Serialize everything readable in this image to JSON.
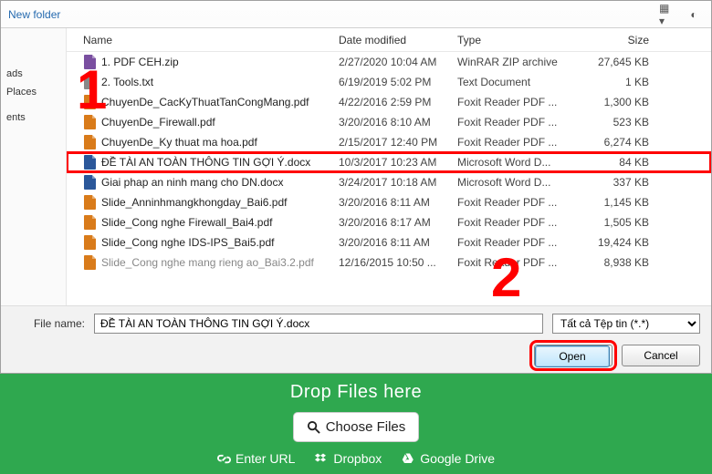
{
  "toolbar": {
    "new_folder": "New folder"
  },
  "sidebar": {
    "items": [
      "ads",
      "Places",
      "",
      "ents"
    ]
  },
  "columns": {
    "name": "Name",
    "date": "Date modified",
    "type": "Type",
    "size": "Size"
  },
  "files": [
    {
      "icon": "zip",
      "name": "1. PDF CEH.zip",
      "date": "2/27/2020 10:04 AM",
      "type": "WinRAR ZIP archive",
      "size": "27,645 KB"
    },
    {
      "icon": "txt",
      "name": "2. Tools.txt",
      "date": "6/19/2019 5:02 PM",
      "type": "Text Document",
      "size": "1 KB"
    },
    {
      "icon": "pdf",
      "name": "ChuyenDe_CacKyThuatTanCongMang.pdf",
      "date": "4/22/2016 2:59 PM",
      "type": "Foxit Reader PDF ...",
      "size": "1,300 KB"
    },
    {
      "icon": "pdf",
      "name": "ChuyenDe_Firewall.pdf",
      "date": "3/20/2016 8:10 AM",
      "type": "Foxit Reader PDF ...",
      "size": "523 KB"
    },
    {
      "icon": "pdf",
      "name": "ChuyenDe_Ky thuat ma hoa.pdf",
      "date": "2/15/2017 12:40 PM",
      "type": "Foxit Reader PDF ...",
      "size": "6,274 KB"
    },
    {
      "icon": "doc",
      "name": "ĐỀ TÀI AN TOÀN THÔNG TIN GỢI Ý.docx",
      "date": "10/3/2017 10:23 AM",
      "type": "Microsoft Word D...",
      "size": "84 KB",
      "highlight": true
    },
    {
      "icon": "doc",
      "name": "Giai phap an ninh mang cho DN.docx",
      "date": "3/24/2017 10:18 AM",
      "type": "Microsoft Word D...",
      "size": "337 KB"
    },
    {
      "icon": "pdf",
      "name": "Slide_Anninhmangkhongday_Bai6.pdf",
      "date": "3/20/2016 8:11 AM",
      "type": "Foxit Reader PDF ...",
      "size": "1,145 KB"
    },
    {
      "icon": "pdf",
      "name": "Slide_Cong nghe Firewall_Bai4.pdf",
      "date": "3/20/2016 8:17 AM",
      "type": "Foxit Reader PDF ...",
      "size": "1,505 KB"
    },
    {
      "icon": "pdf",
      "name": "Slide_Cong nghe IDS-IPS_Bai5.pdf",
      "date": "3/20/2016 8:11 AM",
      "type": "Foxit Reader PDF ...",
      "size": "19,424 KB"
    },
    {
      "icon": "pdf",
      "name": "Slide_Cong nghe mang rieng ao_Bai3.2.pdf",
      "date": "12/16/2015 10:50 ...",
      "type": "Foxit Reader PDF ...",
      "size": "8,938 KB",
      "cut": true
    }
  ],
  "bottom": {
    "filename_label": "File name:",
    "filename_value": "ĐỀ TÀI AN TOÀN THÔNG TIN GỢI Ý.docx",
    "filetype_selected": "Tất cả Tệp tin (*.*)",
    "open": "Open",
    "cancel": "Cancel"
  },
  "green": {
    "drop": "Drop Files here",
    "choose": "Choose Files",
    "enter_url": "Enter URL",
    "dropbox": "Dropbox",
    "gdrive": "Google Drive"
  },
  "annotations": {
    "one": "1",
    "two": "2"
  },
  "icon_colors": {
    "zip": "#7a4fa0",
    "txt": "#888",
    "pdf": "#d97b1a",
    "doc": "#2b579a"
  }
}
